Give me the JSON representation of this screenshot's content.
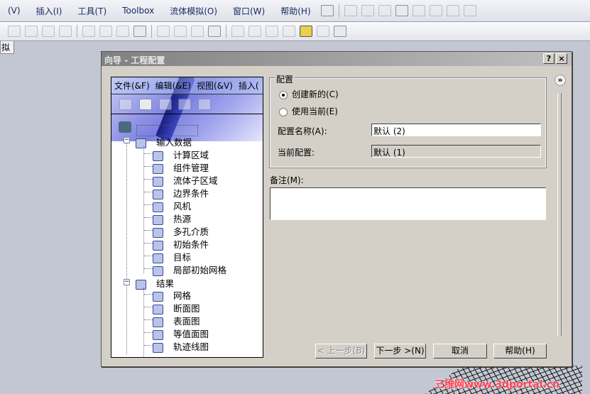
{
  "menubar": {
    "items": [
      "(V)",
      "插入(I)",
      "工具(T)",
      "Toolbox",
      "流体模拟(O)",
      "窗口(W)",
      "帮助(H)"
    ]
  },
  "doc_tab": "拟",
  "dialog": {
    "title": "向导 - 工程配置",
    "help_btn": "?",
    "close_btn": "×",
    "tree_menu": [
      "文件(&F)",
      "编辑(&E)",
      "视图(&V)",
      "插入("
    ],
    "tree": {
      "input_label": "输入数据",
      "input_items": [
        "计算区域",
        "组件管理",
        "流体子区域",
        "边界条件",
        "风机",
        "热源",
        "多孔介质",
        "初始条件",
        "目标",
        "局部初始网格"
      ],
      "results_label": "结果",
      "results_items": [
        "网格",
        "断面图",
        "表面图",
        "等值面图",
        "轨迹线图"
      ]
    },
    "config_group": {
      "title": "配置",
      "radio_new": "创建新的(C)",
      "radio_current": "使用当前(E)",
      "name_label": "配置名称(A):",
      "name_value": "默认 (2)",
      "current_label": "当前配置:",
      "current_value": "默认 (1)"
    },
    "notes_label": "备注(M):",
    "notes_value": "",
    "expand": "»",
    "buttons": {
      "back": "< 上一步(B)",
      "next": "下一步 >(N)",
      "cancel": "取消",
      "help": "帮助(H)"
    }
  },
  "watermark": "三维网www.3dportal.cn"
}
